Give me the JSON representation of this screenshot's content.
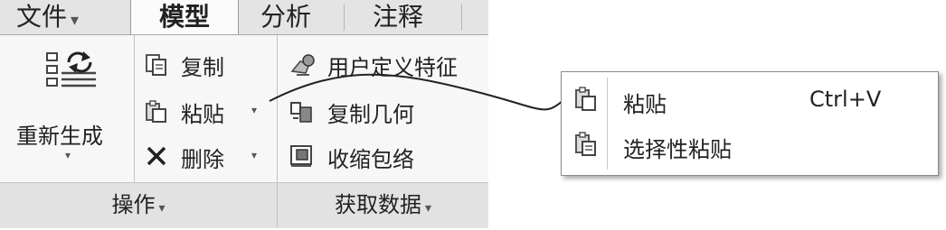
{
  "tabs": [
    {
      "label": "文件",
      "caret": "▾"
    },
    {
      "label": "模型"
    },
    {
      "label": "分析"
    },
    {
      "label": "注释"
    }
  ],
  "groups": {
    "operations": {
      "footer": "操作",
      "regenerate_label_1": "重新生成",
      "copy": "复制",
      "paste": "粘贴",
      "delete": "删除"
    },
    "get_data": {
      "footer": "获取数据",
      "user_defined": "用户定义特征",
      "copy_geometry": "复制几何",
      "shrinkwrap": "收缩包络"
    }
  },
  "caret": "▾",
  "popup": {
    "items": [
      {
        "label": "粘贴",
        "shortcut": "Ctrl+V",
        "icon": "paste-icon"
      },
      {
        "label": "选择性粘贴",
        "shortcut": "",
        "icon": "paste-special-icon"
      }
    ]
  }
}
